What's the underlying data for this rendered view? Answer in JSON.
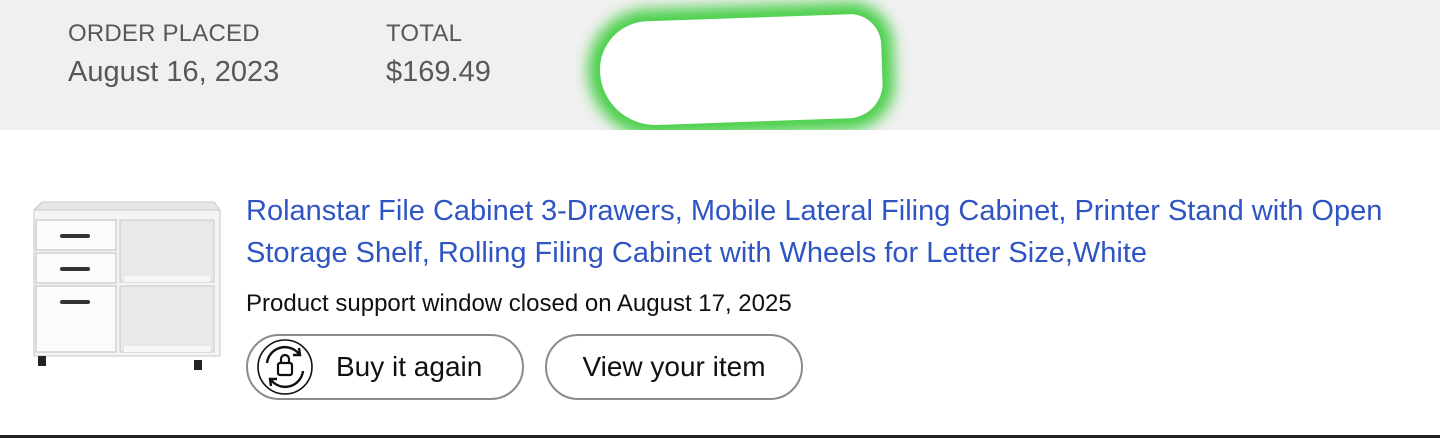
{
  "order": {
    "placed_label": "ORDER PLACED",
    "placed_value": "August 16, 2023",
    "total_label": "TOTAL",
    "total_value": "$169.49"
  },
  "item": {
    "title": "Rolanstar File Cabinet 3-Drawers, Mobile Lateral Filing Cabinet, Printer Stand with Open Storage Shelf, Rolling Filing Cabinet with Wheels for Letter Size,White",
    "support_text": "Product support window closed on August 17, 2025",
    "thumbnail_icon": "file-cabinet-image"
  },
  "actions": {
    "buy_again_label": "Buy it again",
    "buy_again_icon": "reorder-icon",
    "view_item_label": "View your item"
  },
  "colors": {
    "header_bg": "#f0f0f0",
    "link": "#2f55c4",
    "redaction_glow": "#4cd04c"
  }
}
